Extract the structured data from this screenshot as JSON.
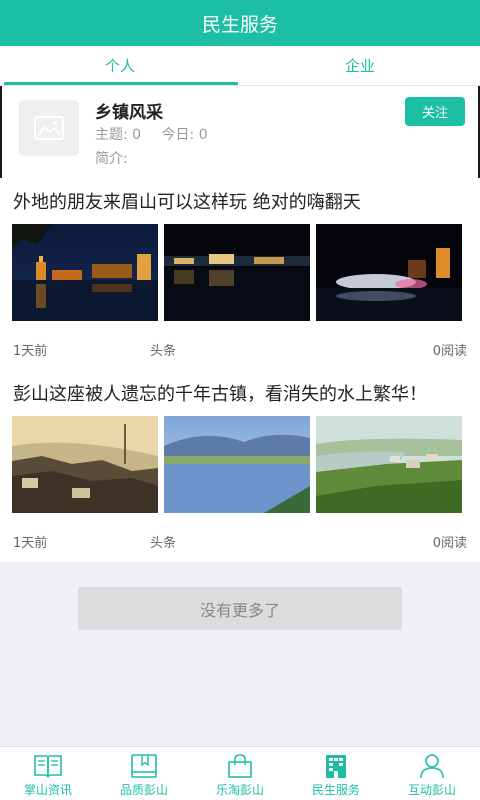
{
  "header": {
    "title": "民生服务"
  },
  "tabs": [
    {
      "label": "个人",
      "active": true
    },
    {
      "label": "企业",
      "active": false
    }
  ],
  "profile": {
    "name": "乡镇风采",
    "topics_label": "主题: 0",
    "today_label": "今日: 0",
    "intro_label": "简介:",
    "follow_label": "关注"
  },
  "articles": [
    {
      "title": "外地的朋友来眉山可以这样玩 绝对的嗨翻天",
      "time": "1天前",
      "source": "头条",
      "reads": "0阅读",
      "images": [
        "night-city-river-photo",
        "night-waterfront-photo",
        "night-fountain-photo"
      ]
    },
    {
      "title": "彭山这座被人遗忘的千年古镇，看消失的水上繁华！",
      "time": "1天前",
      "source": "头条",
      "reads": "0阅读",
      "images": [
        "old-town-roofs-photo",
        "river-landscape-photo",
        "town-aerial-photo"
      ]
    }
  ],
  "load_more": {
    "label": "没有更多了"
  },
  "bottom_nav": [
    {
      "label": "掌山资讯",
      "icon": "book-open-icon"
    },
    {
      "label": "品质彭山",
      "icon": "bookmark-book-icon"
    },
    {
      "label": "乐淘彭山",
      "icon": "shopping-bag-icon"
    },
    {
      "label": "民生服务",
      "icon": "building-icon"
    },
    {
      "label": "互动彭山",
      "icon": "user-icon"
    }
  ],
  "colors": {
    "accent": "#1dbfa4",
    "background": "#efeff4"
  }
}
